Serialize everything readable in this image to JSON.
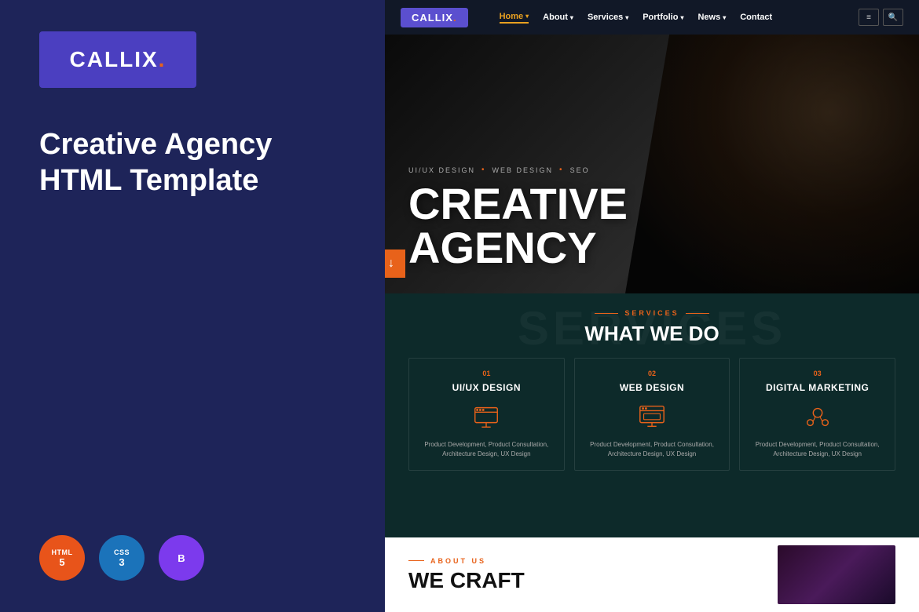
{
  "left_panel": {
    "logo_text": "CALLIX",
    "logo_dot": ".",
    "title_line1": "Creative Agency",
    "title_line2": "HTML Template",
    "badges": [
      {
        "id": "html",
        "top": "HTML",
        "num": "5",
        "bg": "html"
      },
      {
        "id": "css",
        "top": "CSS",
        "num": "3",
        "bg": "css"
      },
      {
        "id": "bootstrap",
        "symbol": "B",
        "bg": "bootstrap"
      }
    ]
  },
  "navbar": {
    "logo": "CALLIX",
    "logo_dot": ".",
    "links": [
      {
        "label": "Home",
        "active": true,
        "has_arrow": true
      },
      {
        "label": "About",
        "active": false,
        "has_arrow": true
      },
      {
        "label": "Services",
        "active": false,
        "has_arrow": true
      },
      {
        "label": "Portfolio",
        "active": false,
        "has_arrow": true
      },
      {
        "label": "News",
        "active": false,
        "has_arrow": true
      },
      {
        "label": "Contact",
        "active": false,
        "has_arrow": false
      }
    ],
    "search_placeholder": "Search..."
  },
  "hero": {
    "subtitle_parts": [
      "UI/UX DESIGN",
      "WEB DESIGN",
      "SEO"
    ],
    "title_line1": "CREATIVE",
    "title_line2": "AGENCY"
  },
  "services_section": {
    "bg_text": "SERVICES",
    "label": "SERVICES",
    "title": "WHAT WE DO",
    "cards": [
      {
        "num": "01",
        "name": "UI/UX DESIGN",
        "desc": "Product Development, Product Consultation, Architecture Design, UX Design"
      },
      {
        "num": "02",
        "name": "WEB DESIGN",
        "desc": "Product Development, Product Consultation, Architecture Design, UX Design"
      },
      {
        "num": "03",
        "name": "DIGITAL MARKETING",
        "desc": "Product Development, Product Consultation, Architecture Design, UX Design"
      }
    ]
  },
  "about_section": {
    "label": "ABOUT US",
    "title": "WE CRAFT"
  }
}
